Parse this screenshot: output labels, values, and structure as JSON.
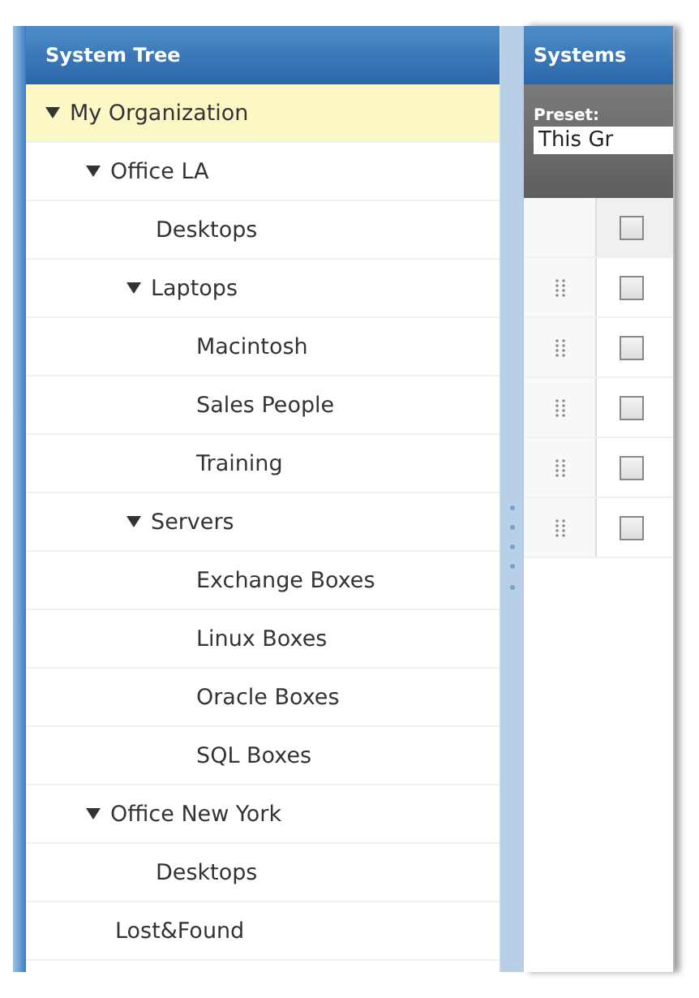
{
  "tree_panel": {
    "title": "System Tree",
    "items": [
      {
        "label": "My Organization",
        "expanded": true,
        "selected": true,
        "children": [
          {
            "label": "Office LA",
            "expanded": true,
            "selected": false,
            "children": [
              {
                "label": "Desktops",
                "selected": false
              },
              {
                "label": "Laptops",
                "expanded": true,
                "selected": false,
                "children": [
                  {
                    "label": "Macintosh",
                    "selected": false
                  },
                  {
                    "label": "Sales People",
                    "selected": false
                  },
                  {
                    "label": "Training",
                    "selected": false
                  }
                ]
              },
              {
                "label": "Servers",
                "expanded": true,
                "selected": false,
                "children": [
                  {
                    "label": "Exchange Boxes",
                    "selected": false
                  },
                  {
                    "label": "Linux Boxes",
                    "selected": false
                  },
                  {
                    "label": "Oracle Boxes",
                    "selected": false
                  },
                  {
                    "label": "SQL Boxes",
                    "selected": false
                  }
                ]
              }
            ]
          },
          {
            "label": "Office New York",
            "expanded": true,
            "selected": false,
            "children": [
              {
                "label": "Desktops",
                "selected": false
              }
            ]
          },
          {
            "label": "Lost&Found",
            "selected": false
          }
        ]
      }
    ]
  },
  "systems_panel": {
    "title": "Systems",
    "preset": {
      "label": "Preset:",
      "value": "This Gr"
    },
    "header_row": {
      "checked": false
    },
    "rows": [
      {
        "checked": false
      },
      {
        "checked": false
      },
      {
        "checked": false
      },
      {
        "checked": false
      },
      {
        "checked": false
      }
    ]
  }
}
